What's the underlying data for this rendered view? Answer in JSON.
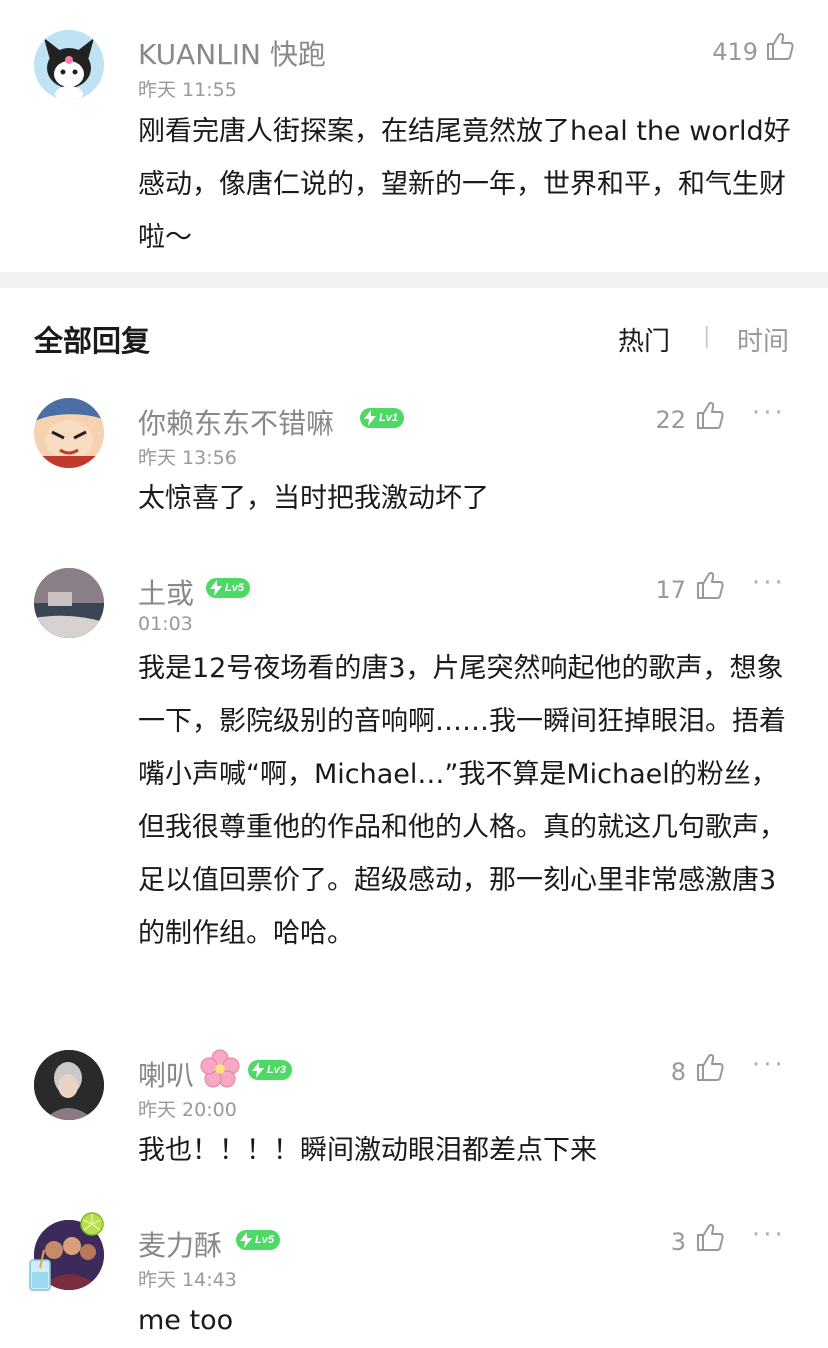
{
  "post": {
    "author": "KUANLIN 快跑",
    "time": "昨天 11:55",
    "likes": "419",
    "content": "刚看完唐人街探案，在结尾竟然放了heal the world好感动，像唐仁说的，望新的一年，世界和平，和气生财啦～"
  },
  "section": {
    "title": "全部回复",
    "sort_hot": "热门",
    "sort_separator": "|",
    "sort_time": "时间"
  },
  "replies": [
    {
      "name": "你赖东东不错嘛",
      "level": "Lv1",
      "time": "昨天 13:56",
      "likes": "22",
      "content": "太惊喜了，当时把我激动坏了"
    },
    {
      "name": "土或",
      "level": "Lv5",
      "time": "01:03",
      "likes": "17",
      "content": "我是12号夜场看的唐3，片尾突然响起他的歌声，想象一下，影院级别的音响啊……我一瞬间狂掉眼泪。捂着嘴小声喊“啊，Michael…”我不算是Michael的粉丝，但我很尊重他的作品和他的人格。真的就这几句歌声，足以值回票价了。超级感动，那一刻心里非常感激唐3的制作组。哈哈。"
    },
    {
      "name": "喇叭",
      "level": "Lv3",
      "time": "昨天 20:00",
      "likes": "8",
      "content": "我也！！！！瞬间激动眼泪都差点下来"
    },
    {
      "name": "麦力酥",
      "level": "Lv5",
      "time": "昨天 14:43",
      "likes": "3",
      "content": "me too"
    }
  ],
  "more_label": "···",
  "colors": {
    "badge": "#4cd964",
    "meta": "#999999",
    "text": "#1a1a1a",
    "divider": "#f1f1f1"
  },
  "icons": {
    "like": "thumbs-up-icon",
    "more": "more-dots-icon",
    "badge": "lightning-icon"
  }
}
